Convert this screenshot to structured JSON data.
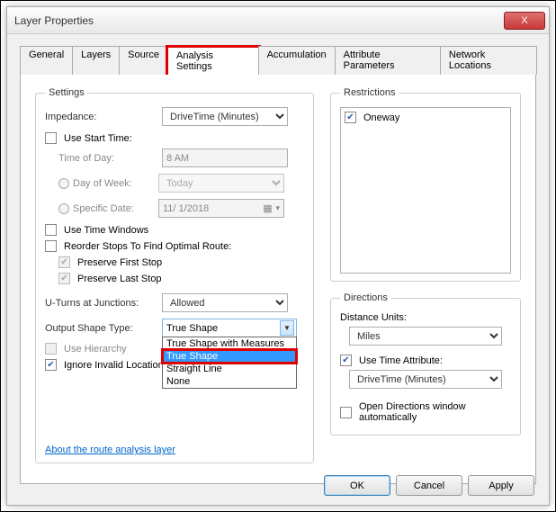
{
  "window": {
    "title": "Layer Properties",
    "close_x": "X"
  },
  "tabs": {
    "general": "General",
    "layers": "Layers",
    "source": "Source",
    "analysis": "Analysis Settings",
    "accumulation": "Accumulation",
    "attribute_params": "Attribute Parameters",
    "network_locations": "Network Locations"
  },
  "settings": {
    "legend": "Settings",
    "impedance_label": "Impedance:",
    "impedance_value": "DriveTime (Minutes)",
    "use_start_time": "Use Start Time:",
    "time_of_day_label": "Time of Day:",
    "time_of_day_value": "8 AM",
    "day_of_week_label": "Day of Week:",
    "day_of_week_value": "Today",
    "specific_date_label": "Specific Date:",
    "specific_date_value": "11/  1/2018",
    "use_time_windows": "Use Time Windows",
    "reorder_stops": "Reorder Stops To Find Optimal Route:",
    "preserve_first": "Preserve First Stop",
    "preserve_last": "Preserve Last Stop",
    "uturns_label": "U-Turns at Junctions:",
    "uturns_value": "Allowed",
    "output_shape_label": "Output Shape Type:",
    "output_shape_value": "True Shape",
    "output_shape_options": [
      "True Shape with Measures",
      "True Shape",
      "Straight Line",
      "None"
    ],
    "use_hierarchy": "Use Hierarchy",
    "ignore_invalid": "Ignore Invalid Locations",
    "about_link": "About the route analysis layer"
  },
  "restrictions": {
    "legend": "Restrictions",
    "oneway": "Oneway"
  },
  "directions": {
    "legend": "Directions",
    "distance_units_label": "Distance Units:",
    "distance_units_value": "Miles",
    "use_time_attr": "Use Time Attribute:",
    "time_attr_value": "DriveTime (Minutes)",
    "open_directions": "Open Directions window automatically"
  },
  "buttons": {
    "ok": "OK",
    "cancel": "Cancel",
    "apply": "Apply"
  }
}
